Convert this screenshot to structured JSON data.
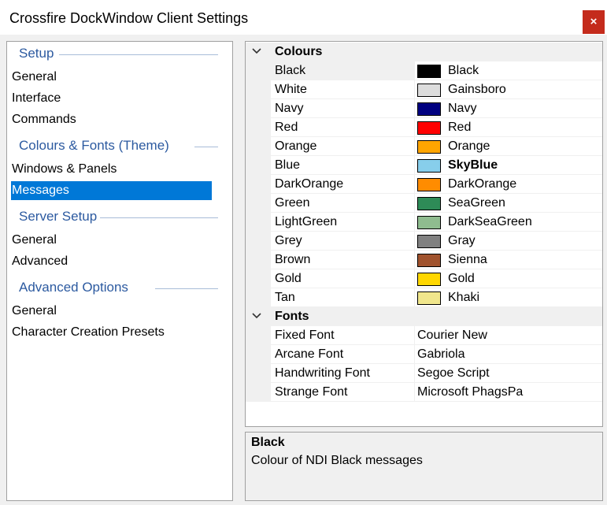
{
  "window": {
    "title": "Crossfire DockWindow Client Settings",
    "close_label": "×"
  },
  "nav": {
    "groups": [
      {
        "label": "Setup",
        "items": [
          "General",
          "Interface",
          "Commands"
        ]
      },
      {
        "label": "Colours & Fonts (Theme)",
        "items": [
          "Windows & Panels",
          "Messages"
        ]
      },
      {
        "label": "Server Setup",
        "items": [
          "General",
          "Advanced"
        ]
      },
      {
        "label": "Advanced Options",
        "items": [
          "General",
          "Character Creation Presets"
        ]
      }
    ],
    "selected": "Messages",
    "accent": "#0078d7"
  },
  "grid": {
    "categories": [
      {
        "label": "Colours",
        "expanded": true,
        "rows": [
          {
            "name": "Black",
            "value": "Black",
            "color": "#000000"
          },
          {
            "name": "White",
            "value": "Gainsboro",
            "color": "#dcdcdc"
          },
          {
            "name": "Navy",
            "value": "Navy",
            "color": "#000080"
          },
          {
            "name": "Red",
            "value": "Red",
            "color": "#ff0000"
          },
          {
            "name": "Orange",
            "value": "Orange",
            "color": "#ffa500"
          },
          {
            "name": "Blue",
            "value": "SkyBlue",
            "color": "#87ceeb",
            "bold": true
          },
          {
            "name": "DarkOrange",
            "value": "DarkOrange",
            "color": "#ff8c00"
          },
          {
            "name": "Green",
            "value": "SeaGreen",
            "color": "#2e8b57"
          },
          {
            "name": "LightGreen",
            "value": "DarkSeaGreen",
            "color": "#8fbc8f"
          },
          {
            "name": "Grey",
            "value": "Gray",
            "color": "#808080"
          },
          {
            "name": "Brown",
            "value": "Sienna",
            "color": "#a0522d"
          },
          {
            "name": "Gold",
            "value": "Gold",
            "color": "#ffd700"
          },
          {
            "name": "Tan",
            "value": "Khaki",
            "color": "#f0e68c"
          }
        ]
      },
      {
        "label": "Fonts",
        "expanded": true,
        "rows": [
          {
            "name": "Fixed Font",
            "value": "Courier New"
          },
          {
            "name": "Arcane Font",
            "value": "Gabriola"
          },
          {
            "name": "Handwriting Font",
            "value": "Segoe Script"
          },
          {
            "name": "Strange Font",
            "value": "Microsoft PhagsPa"
          }
        ]
      }
    ],
    "selected_row": "Black"
  },
  "description": {
    "title": "Black",
    "text": "Colour of NDI Black messages"
  }
}
